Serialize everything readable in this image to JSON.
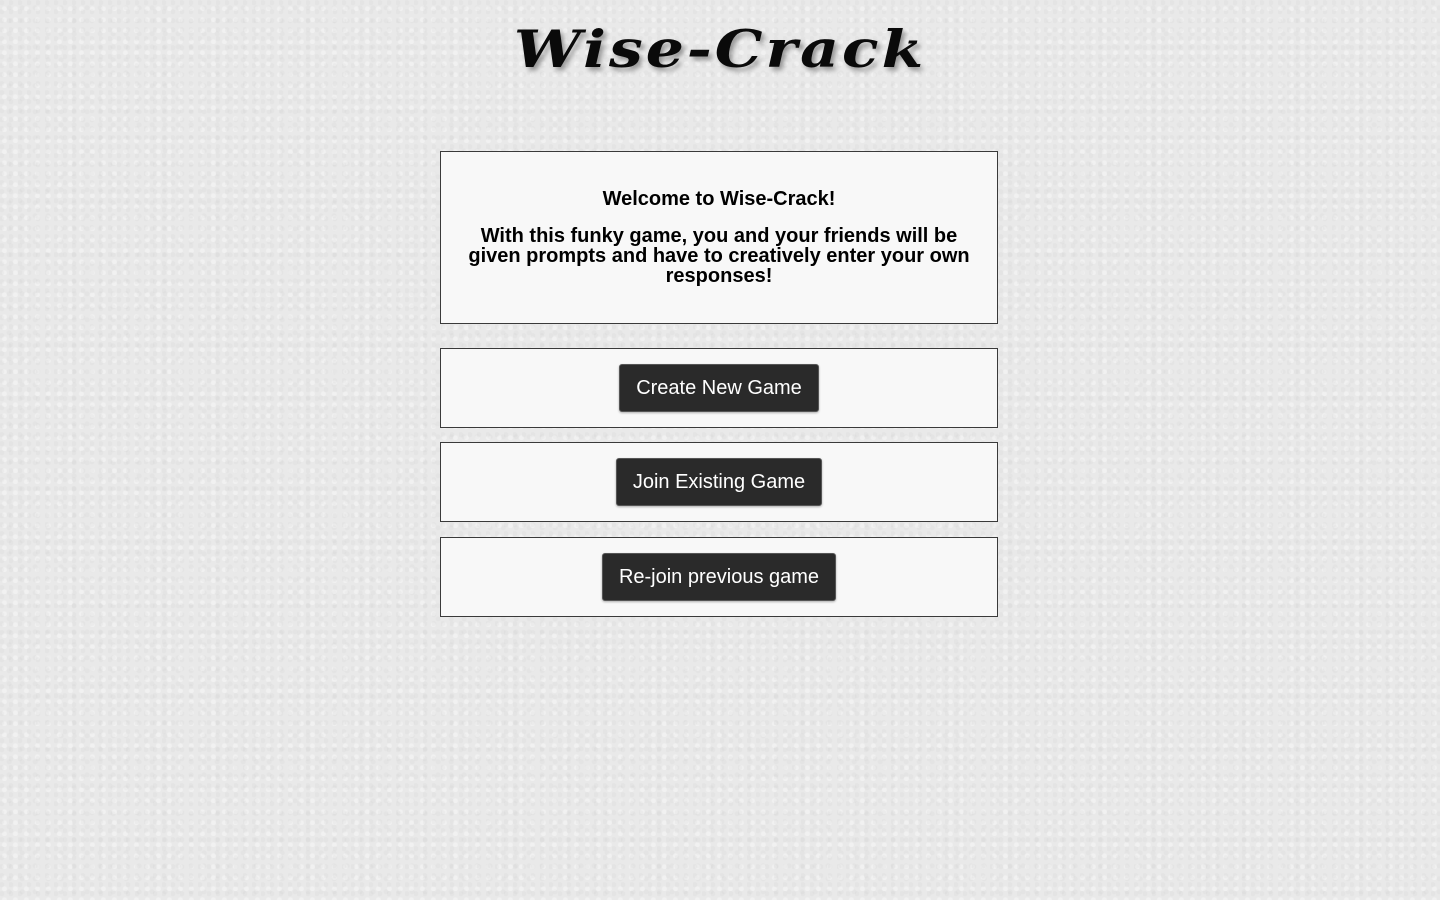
{
  "header": {
    "logo_text": "Wise-Crack"
  },
  "welcome": {
    "title": "Welcome to Wise-Crack!",
    "description": "With this funky game, you and your friends will be given prompts and have to creatively enter your own responses!"
  },
  "actions": {
    "create_label": "Create New Game",
    "join_label": "Join Existing Game",
    "rejoin_label": "Re-join previous game"
  },
  "colors": {
    "background": "#e9e9e9",
    "panel_background": "#f8f8f8",
    "button_background": "#2a2a2a",
    "button_text": "#ffffff"
  }
}
